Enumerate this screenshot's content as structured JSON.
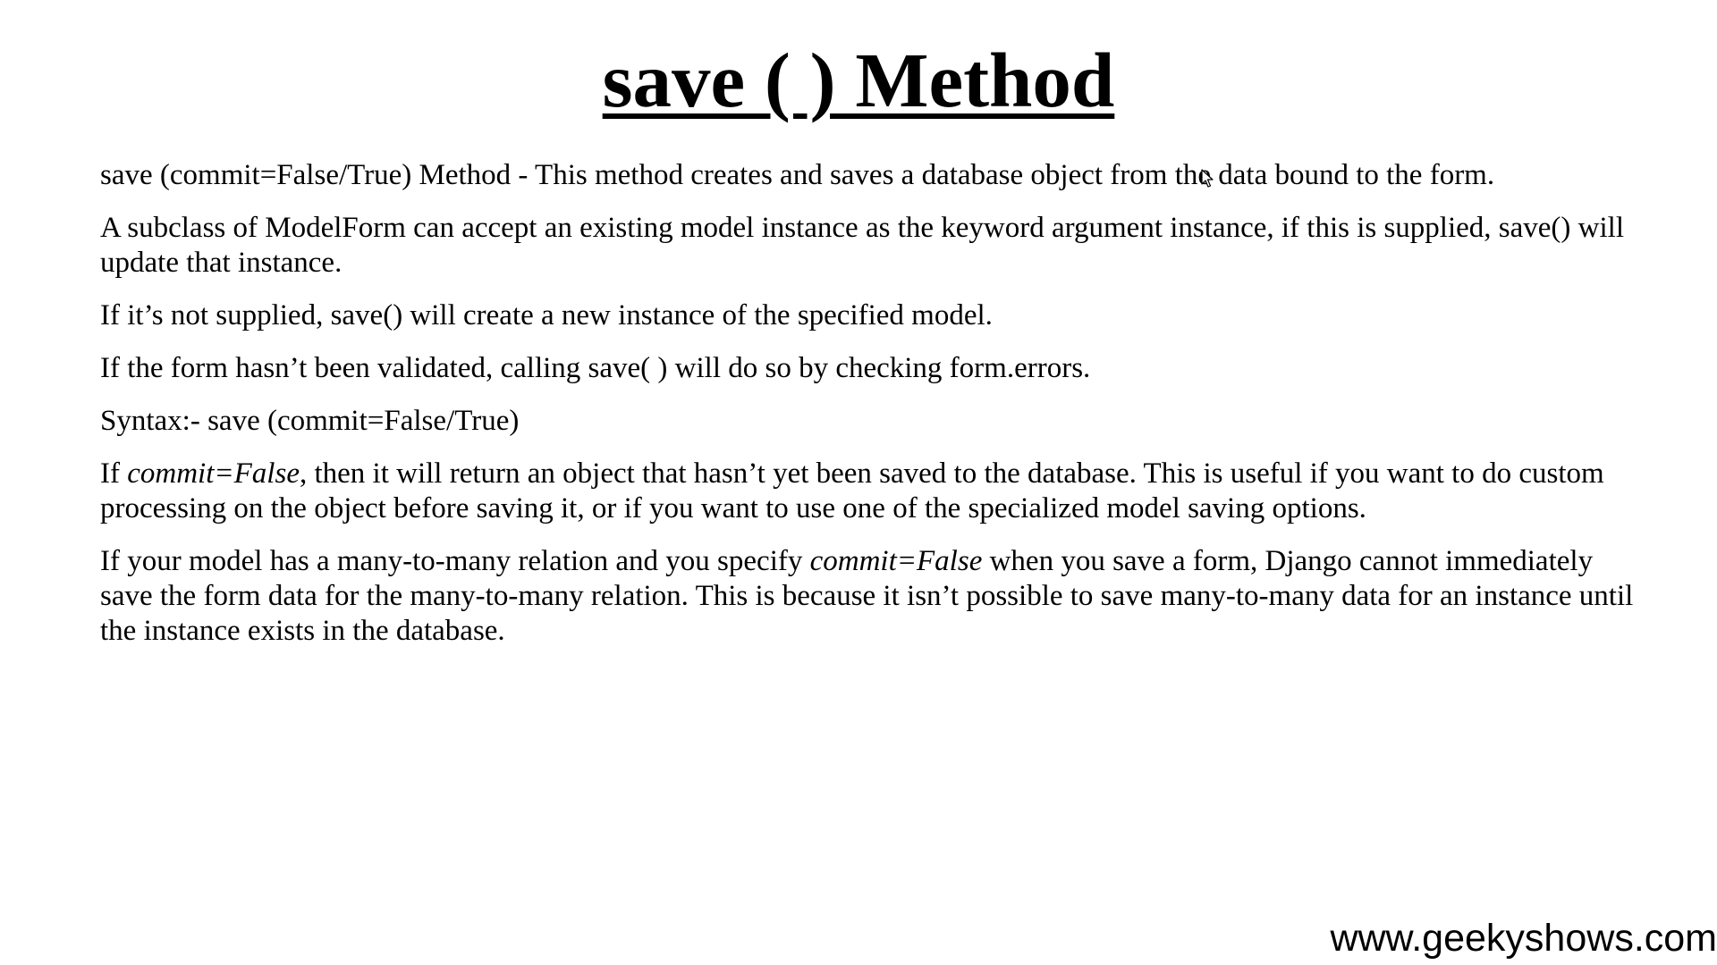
{
  "slide": {
    "title": "save ( ) Method",
    "paragraphs": [
      {
        "text": "save (commit=False/True) Method - This method creates and saves a database object from the data bound to the form."
      },
      {
        "text": "A subclass of ModelForm can accept an existing model instance as the keyword argument instance, if this is supplied, save() will update that instance."
      },
      {
        "text": "If it’s not supplied, save() will create a new instance of the specified model."
      },
      {
        "text": "If the form hasn’t been validated, calling save( ) will do so by checking form.errors."
      },
      {
        "text": "Syntax:- save (commit=False/True)"
      },
      {
        "before": "If ",
        "italic": "commit=False",
        "after": ", then it will return an object that hasn’t yet been saved to the database. This is useful if you want to do custom processing on the object before saving it, or if you want to use one of the specialized model saving options."
      },
      {
        "before": "If your model has a many-to-many relation and you specify ",
        "italic": "commit=False",
        "after": " when you save a form, Django cannot immediately save the form data for the many-to-many relation. This is because it isn’t possible to save many-to-many data for an instance until the instance exists in the database."
      }
    ],
    "footer": "www.geekyshows.com"
  },
  "cursor_icon": "mouse-pointer-icon"
}
